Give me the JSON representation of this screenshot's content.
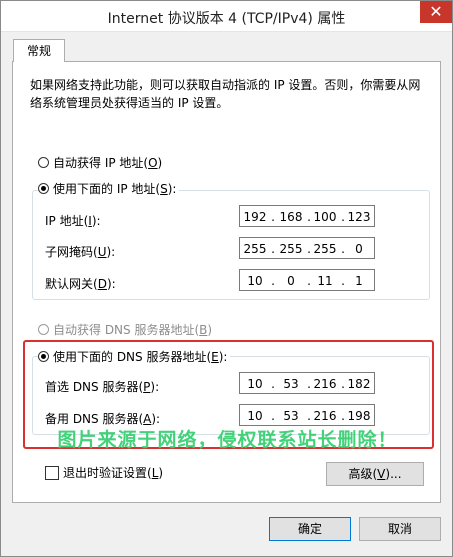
{
  "window": {
    "title": "Internet 协议版本 4 (TCP/IPv4) 属性",
    "close_glyph": "✕"
  },
  "tab": {
    "label": "常规"
  },
  "description": "如果网络支持此功能，则可以获取自动指派的 IP 设置。否则，你需要从网络系统管理员处获得适当的 IP 设置。",
  "ip": {
    "auto_label": "自动获得 IP 地址(",
    "auto_key": "O",
    "manual_label": "使用下面的 IP 地址(",
    "manual_key": "S",
    "address": {
      "label": "IP 地址(",
      "key": "I",
      "octets": [
        "192",
        "168",
        "100",
        "123"
      ]
    },
    "subnet": {
      "label": "子网掩码(",
      "key": "U",
      "octets": [
        "255",
        "255",
        "255",
        "0"
      ]
    },
    "gateway": {
      "label": "默认网关(",
      "key": "D",
      "octets": [
        "10",
        "0",
        "11",
        "1"
      ]
    }
  },
  "dns": {
    "auto_label": "自动获得 DNS 服务器地址(",
    "auto_key": "B",
    "manual_label": "使用下面的 DNS 服务器地址(",
    "manual_key": "E",
    "preferred": {
      "label": "首选 DNS 服务器(",
      "key": "P",
      "octets": [
        "10",
        "53",
        "216",
        "182"
      ]
    },
    "alternate": {
      "label": "备用 DNS 服务器(",
      "key": "A",
      "octets": [
        "10",
        "53",
        "216",
        "198"
      ]
    }
  },
  "watermark": "图片来源于网络，侵权联系站长删除！",
  "validate": {
    "label": "退出时验证设置(",
    "key": "L"
  },
  "buttons": {
    "advanced": "高级(",
    "advanced_key": "V",
    "advanced_suffix": ")...",
    "ok": "确定",
    "cancel": "取消"
  },
  "colors": {
    "highlight": "#d93030",
    "watermark": "#33d06f",
    "close": "#c7352b"
  }
}
